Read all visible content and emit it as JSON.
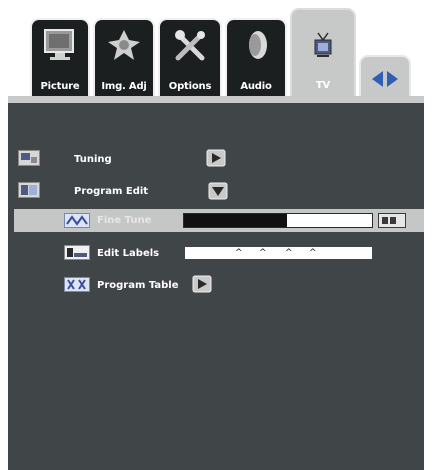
{
  "tabs": [
    {
      "id": "picture",
      "label": "Picture",
      "icon": "monitor-icon"
    },
    {
      "id": "img_adj",
      "label": "Img. Adj",
      "icon": "sparkle-adjust-icon"
    },
    {
      "id": "options",
      "label": "Options",
      "icon": "tools-icon"
    },
    {
      "id": "audio",
      "label": "Audio",
      "icon": "speaker-icon"
    },
    {
      "id": "tv",
      "label": "TV",
      "icon": "antenna-tv-icon",
      "active": true
    },
    {
      "id": "nav",
      "label": "",
      "icon": "left-right-arrows-icon"
    }
  ],
  "menu": {
    "tuning": {
      "label": "Tuning",
      "arrow": "submenu-arrow-icon"
    },
    "program_edit": {
      "label": "Program Edit",
      "arrow": "expanded-arrow-icon"
    },
    "fine_tune": {
      "label": "Fine Tune",
      "level": 0.55
    },
    "edit_labels": {
      "label": "Edit Labels",
      "carets": [
        "^",
        "^",
        "^",
        "^"
      ]
    },
    "program_table": {
      "label": "Program Table",
      "arrow": "submenu-arrow-icon"
    }
  },
  "colors": {
    "panel": "#404548",
    "tab_inactive": "#1c1f20",
    "tab_active": "#c7c9c8",
    "highlight": "#c5c7c6",
    "arrow_blue": "#2f5fb5"
  }
}
